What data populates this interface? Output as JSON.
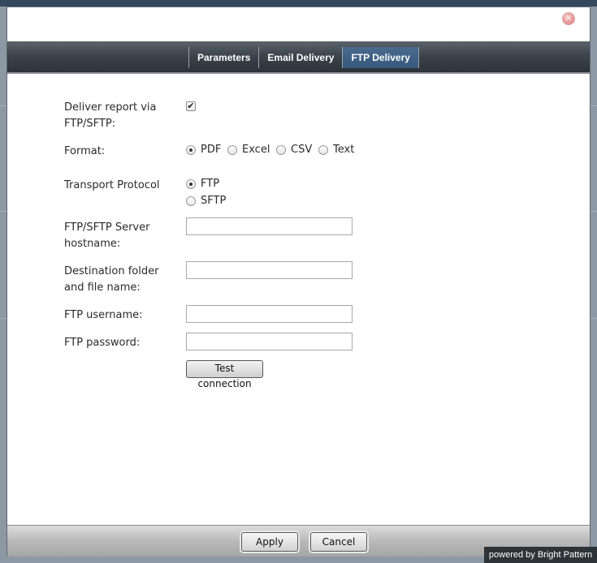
{
  "tabs": [
    "Parameters",
    "Email Delivery",
    "FTP Delivery"
  ],
  "active_tab": "FTP Delivery",
  "form": {
    "deliver_label_line1": "Deliver report via",
    "deliver_label_line2": "FTP/SFTP:",
    "deliver_checked": true,
    "format_label": "Format:",
    "format_options": [
      "PDF",
      "Excel",
      "CSV",
      "Text"
    ],
    "format_selected": "PDF",
    "transport_label": "Transport Protocol",
    "transport_options": [
      "FTP",
      "SFTP"
    ],
    "transport_selected": "FTP",
    "host_label_line1": "FTP/SFTP Server",
    "host_label_line2": "hostname:",
    "host_value": "",
    "dest_label_line1": "Destination folder",
    "dest_label_line2": "and file name:",
    "dest_value": "",
    "user_label": "FTP username:",
    "user_value": "",
    "pass_label": "FTP password:",
    "pass_value": "",
    "test_button": "Test connection"
  },
  "footer": {
    "apply": "Apply",
    "cancel": "Cancel"
  },
  "powered_by": "powered by Bright Pattern",
  "close_icon": "close-icon",
  "check_glyph": "✔"
}
